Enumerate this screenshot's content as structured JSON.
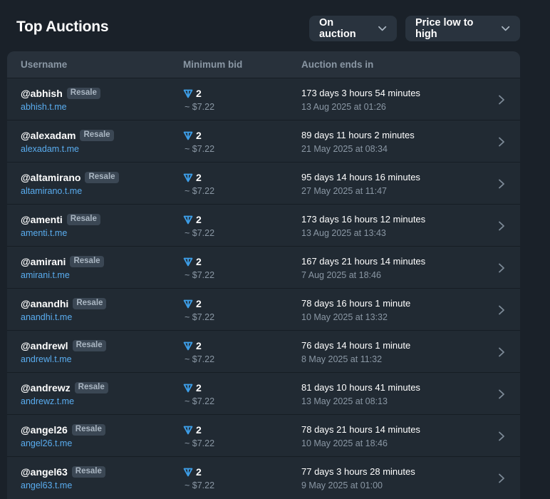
{
  "header": {
    "title": "Top Auctions",
    "status_filter": "On auction",
    "sort_filter": "Price low to high"
  },
  "table": {
    "columns": [
      "Username",
      "Minimum bid",
      "Auction ends in"
    ],
    "rows": [
      {
        "username": "@abhish",
        "badge": "Resale",
        "link": "abhish.t.me",
        "bid": "2",
        "usd": "~ $7.22",
        "ends_in": "173 days 3 hours 54 minutes",
        "ends_date": "13 Aug 2025 at 01:26"
      },
      {
        "username": "@alexadam",
        "badge": "Resale",
        "link": "alexadam.t.me",
        "bid": "2",
        "usd": "~ $7.22",
        "ends_in": "89 days 11 hours 2 minutes",
        "ends_date": "21 May 2025 at 08:34"
      },
      {
        "username": "@altamirano",
        "badge": "Resale",
        "link": "altamirano.t.me",
        "bid": "2",
        "usd": "~ $7.22",
        "ends_in": "95 days 14 hours 16 minutes",
        "ends_date": "27 May 2025 at 11:47"
      },
      {
        "username": "@amenti",
        "badge": "Resale",
        "link": "amenti.t.me",
        "bid": "2",
        "usd": "~ $7.22",
        "ends_in": "173 days 16 hours 12 minutes",
        "ends_date": "13 Aug 2025 at 13:43"
      },
      {
        "username": "@amirani",
        "badge": "Resale",
        "link": "amirani.t.me",
        "bid": "2",
        "usd": "~ $7.22",
        "ends_in": "167 days 21 hours 14 minutes",
        "ends_date": "7 Aug 2025 at 18:46"
      },
      {
        "username": "@anandhi",
        "badge": "Resale",
        "link": "anandhi.t.me",
        "bid": "2",
        "usd": "~ $7.22",
        "ends_in": "78 days 16 hours 1 minute",
        "ends_date": "10 May 2025 at 13:32"
      },
      {
        "username": "@andrewl",
        "badge": "Resale",
        "link": "andrewl.t.me",
        "bid": "2",
        "usd": "~ $7.22",
        "ends_in": "76 days 14 hours 1 minute",
        "ends_date": "8 May 2025 at 11:32"
      },
      {
        "username": "@andrewz",
        "badge": "Resale",
        "link": "andrewz.t.me",
        "bid": "2",
        "usd": "~ $7.22",
        "ends_in": "81 days 10 hours 41 minutes",
        "ends_date": "13 May 2025 at 08:13"
      },
      {
        "username": "@angel26",
        "badge": "Resale",
        "link": "angel26.t.me",
        "bid": "2",
        "usd": "~ $7.22",
        "ends_in": "78 days 21 hours 14 minutes",
        "ends_date": "10 May 2025 at 18:46"
      },
      {
        "username": "@angel63",
        "badge": "Resale",
        "link": "angel63.t.me",
        "bid": "2",
        "usd": "~ $7.22",
        "ends_in": "77 days 3 hours 28 minutes",
        "ends_date": "9 May 2025 at 01:00"
      }
    ]
  },
  "icons": {
    "dropdown": "chevron-down-icon",
    "currency": "ton-icon",
    "row_arrow": "chevron-right-icon"
  },
  "colors": {
    "background": "#1a2129",
    "table": "#212a33",
    "header_row": "#28313b",
    "link": "#5aadf0",
    "ton": "#3d9ee8",
    "muted": "#8a97a4"
  }
}
